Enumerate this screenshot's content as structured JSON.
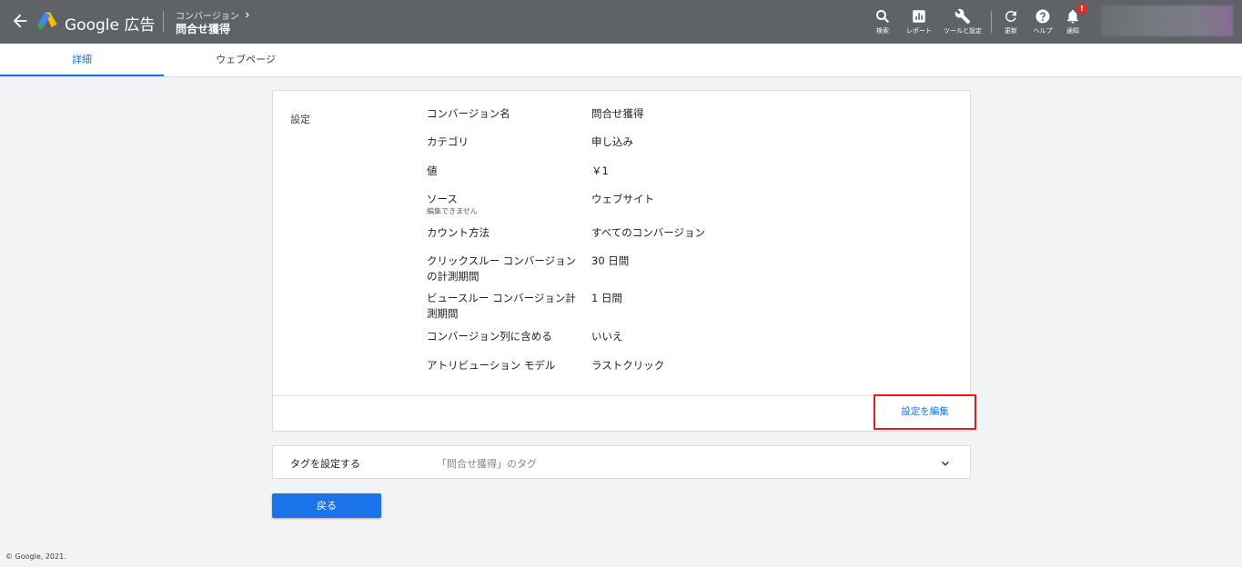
{
  "app": {
    "brand": "Google 広告",
    "breadcrumb_parent": "コンバージョン",
    "breadcrumb_title": "問合せ獲得"
  },
  "toolbar": [
    {
      "label": "検索",
      "icon": "search-icon"
    },
    {
      "label": "レポート",
      "icon": "report-icon"
    },
    {
      "label": "ツールと設定",
      "icon": "wrench-icon"
    },
    {
      "label": "更新",
      "icon": "refresh-icon"
    },
    {
      "label": "ヘルプ",
      "icon": "help-icon"
    },
    {
      "label": "通知",
      "icon": "bell-icon",
      "badge": "!"
    }
  ],
  "tabs": [
    {
      "label": "詳細",
      "active": true
    },
    {
      "label": "ウェブページ",
      "active": false
    }
  ],
  "settings": {
    "section_title": "設定",
    "rows": [
      {
        "label": "コンバージョン名",
        "value": "問合せ獲得"
      },
      {
        "label": "カテゴリ",
        "value": "申し込み"
      },
      {
        "label": "値",
        "value": "￥1"
      },
      {
        "label": "ソース",
        "sublabel": "編集できません",
        "value": "ウェブサイト"
      },
      {
        "label": "カウント方法",
        "value": "すべてのコンバージョン"
      },
      {
        "label": "クリックスルー コンバージョンの計測期間",
        "value": "30 日間"
      },
      {
        "label": "ビュースルー コンバージョン計測期間",
        "value": "1 日間"
      },
      {
        "label": "コンバージョン列に含める",
        "value": "いいえ"
      },
      {
        "label": "アトリビューション モデル",
        "value": "ラストクリック"
      }
    ],
    "edit_label": "設定を編集"
  },
  "tag_panel": {
    "title": "タグを設定する",
    "description": "「問合せ獲得」のタグ"
  },
  "back_label": "戻る",
  "footer": "© Google, 2021.",
  "colors": {
    "topbar": "#5f6368",
    "accent": "#1a73e8",
    "highlight_border": "#e01d1d",
    "notify_badge": "#d93025"
  }
}
